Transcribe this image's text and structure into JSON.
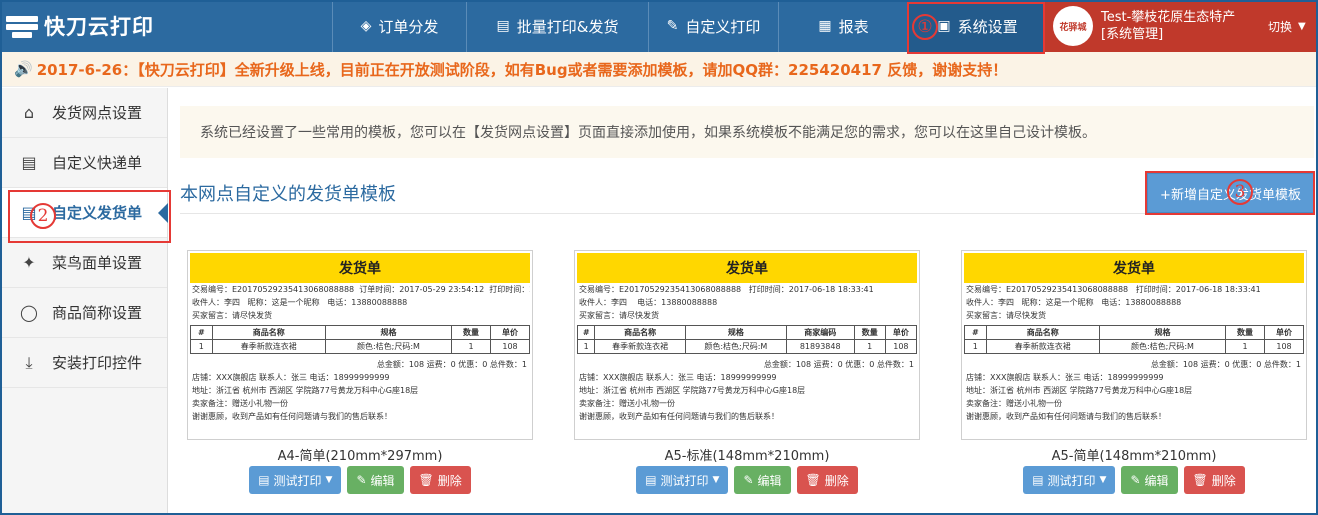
{
  "app": {
    "title": "快刀云打印"
  },
  "nav": {
    "items": [
      {
        "label": "订单分发",
        "icon": "layers-icon"
      },
      {
        "label": "批量打印&发货",
        "icon": "printer-icon"
      },
      {
        "label": "自定义打印",
        "icon": "pencil-icon"
      },
      {
        "label": "报表",
        "icon": "calendar-icon"
      },
      {
        "label": "系统设置",
        "icon": "grid-icon"
      }
    ],
    "active": "系统设置"
  },
  "user": {
    "avatar_text": "花驿城",
    "name": "Test-攀枝花原生态特产",
    "role": "[系统管理]",
    "switch_label": "切换"
  },
  "notice": {
    "text": "2017-6-26：【快刀云打印】全新升级上线，目前正在开放测试阶段，如有Bug或者需要添加模板，请加QQ群：225420417 反馈，谢谢支持！"
  },
  "sidebar": {
    "items": [
      {
        "label": "发货网点设置",
        "icon": "store-icon"
      },
      {
        "label": "自定义快递单",
        "icon": "printer-icon"
      },
      {
        "label": "自定义发货单",
        "icon": "printer-icon"
      },
      {
        "label": "菜鸟面单设置",
        "icon": "bird-icon"
      },
      {
        "label": "商品简称设置",
        "icon": "chat-bubble-icon"
      },
      {
        "label": "安装打印控件",
        "icon": "download-icon"
      }
    ],
    "active": "自定义发货单"
  },
  "annotations": {
    "one": "①",
    "two": "2",
    "three": "3"
  },
  "main": {
    "info": "系统已经设置了一些常用的模板，您可以在【发货网点设置】页面直接添加使用，如果系统模板不能满足您的需求，您可以在这里自己设计模板。",
    "section_title": "本网点自定义的发货单模板",
    "add_button": "+新增自定义发货单模板"
  },
  "preview": {
    "title": "发货单",
    "order_line": "交易编号：E20170529235413068088888",
    "pay_time": "订单时间：2017-05-29 23:54:12",
    "print_time": "打印时间：2017-06-18 18:33:41",
    "receiver": "收件人：李四",
    "nickname": "昵称：这是一个昵称",
    "phone": "电话：13880088888",
    "buyer_msg": "买家留言：请尽快发货",
    "headers_simple": [
      "#",
      "商品名称",
      "规格",
      "数量",
      "单价"
    ],
    "headers_standard": [
      "#",
      "商品名称",
      "规格",
      "商家编码",
      "数量",
      "单价"
    ],
    "row": {
      "no": "1",
      "name": "春季新款连衣裙",
      "spec": "颜色:桔色;尺码:M",
      "code": "81893848",
      "qty": "1",
      "price": "108"
    },
    "totals": "总金额：108    运费：0    优惠：0    总件数：1",
    "shop": "店铺：XXX旗舰店    联系人：张三    电话：18999999999",
    "address": "地址：浙江省 杭州市 西湖区 学院路77号黄龙万科中心G座18层",
    "seller_note": "卖家备注：赠送小礼物一份",
    "thanks": "谢谢惠顾，收到产品如有任何问题请与我们的售后联系！"
  },
  "templates": [
    {
      "caption": "A4-简单(210mm*297mm)",
      "print": "测试打印",
      "edit": "编辑",
      "delete": "删除"
    },
    {
      "caption": "A5-标准(148mm*210mm)",
      "print": "测试打印",
      "edit": "编辑",
      "delete": "删除"
    },
    {
      "caption": "A5-简单(148mm*210mm)",
      "print": "测试打印",
      "edit": "编辑",
      "delete": "删除"
    }
  ]
}
